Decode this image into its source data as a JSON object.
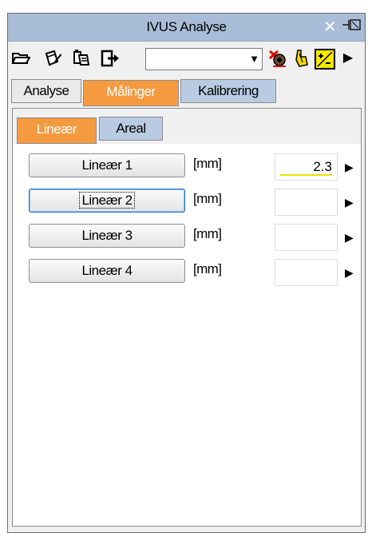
{
  "window": {
    "title": "IVUS Analyse",
    "close_glyph": "✕",
    "pin_glyph": "⊣⊠"
  },
  "toolbar": {
    "icons": [
      "open-folder-icon",
      "edit-document-icon",
      "copy-document-icon",
      "export-icon"
    ],
    "combo_value": "",
    "right_icons": [
      "eye-crossed-icon",
      "cursor-hand-icon",
      "yellow-plus-minus-icon",
      "overflow-arrow-icon"
    ]
  },
  "tabs": [
    {
      "label": "Analyse"
    },
    {
      "label": "Målinger"
    },
    {
      "label": "Kalibrering"
    }
  ],
  "subtabs": [
    {
      "label": "Lineær"
    },
    {
      "label": "Areal"
    }
  ],
  "measurements": [
    {
      "button": "Lineær 1",
      "unit": "[mm]",
      "value": "2.3"
    },
    {
      "button": "Lineær 2",
      "unit": "[mm]",
      "value": ""
    },
    {
      "button": "Lineær 3",
      "unit": "[mm]",
      "value": ""
    },
    {
      "button": "Lineær 4",
      "unit": "[mm]",
      "value": ""
    }
  ],
  "colors": {
    "title_bar": "#a9bdd8",
    "active_tab": "#f59a3e",
    "inactive_blue_tab": "#b8cbe2",
    "value_underline": "#f0e000"
  }
}
